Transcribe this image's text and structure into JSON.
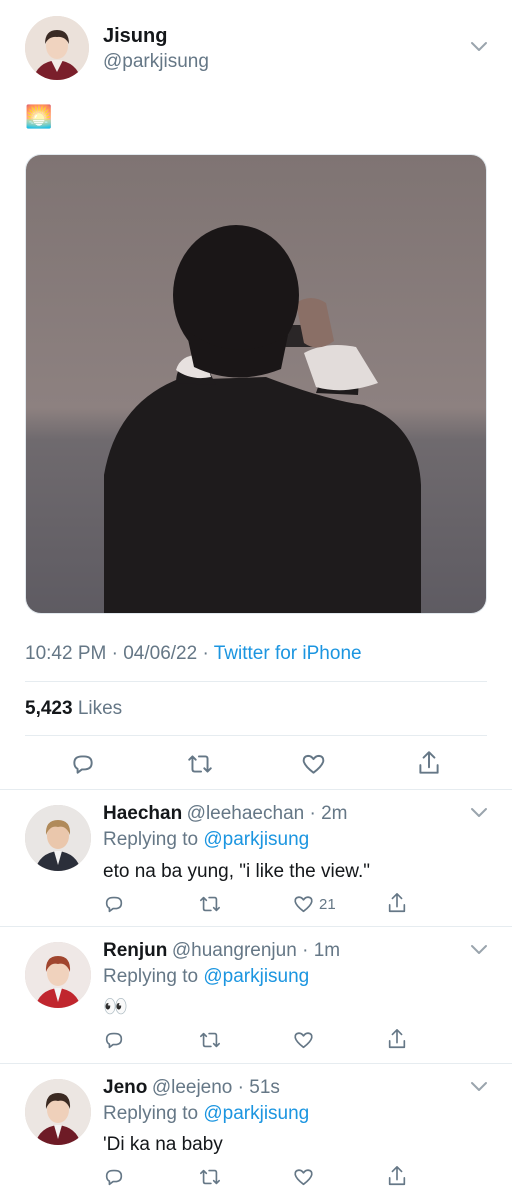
{
  "tweet": {
    "author_name": "Jisung",
    "author_handle": "@parkjisung",
    "emoji": "🌅",
    "time": "10:42 PM",
    "date": "04/06/22",
    "source": "Twitter for iPhone",
    "likes_count": "5,423",
    "likes_label": "Likes"
  },
  "replies": [
    {
      "name": "Haechan",
      "handle": "@leehaechan",
      "time": "2m",
      "replying_prefix": "Replying to",
      "replying_to": "@parkjisung",
      "text": "eto na ba yung, \"i like the view.\"",
      "like_count": "21"
    },
    {
      "name": "Renjun",
      "handle": "@huangrenjun",
      "time": "1m",
      "replying_prefix": "Replying to",
      "replying_to": "@parkjisung",
      "text": "👀",
      "like_count": ""
    },
    {
      "name": "Jeno",
      "handle": "@leejeno",
      "time": "51s",
      "replying_prefix": "Replying to",
      "replying_to": "@parkjisung",
      "text": "'Di ka na baby",
      "like_count": ""
    }
  ],
  "separator": "·",
  "colors": {
    "link": "#1b95e0",
    "muted": "#657786",
    "photo_sky": "#8a7f7e"
  }
}
